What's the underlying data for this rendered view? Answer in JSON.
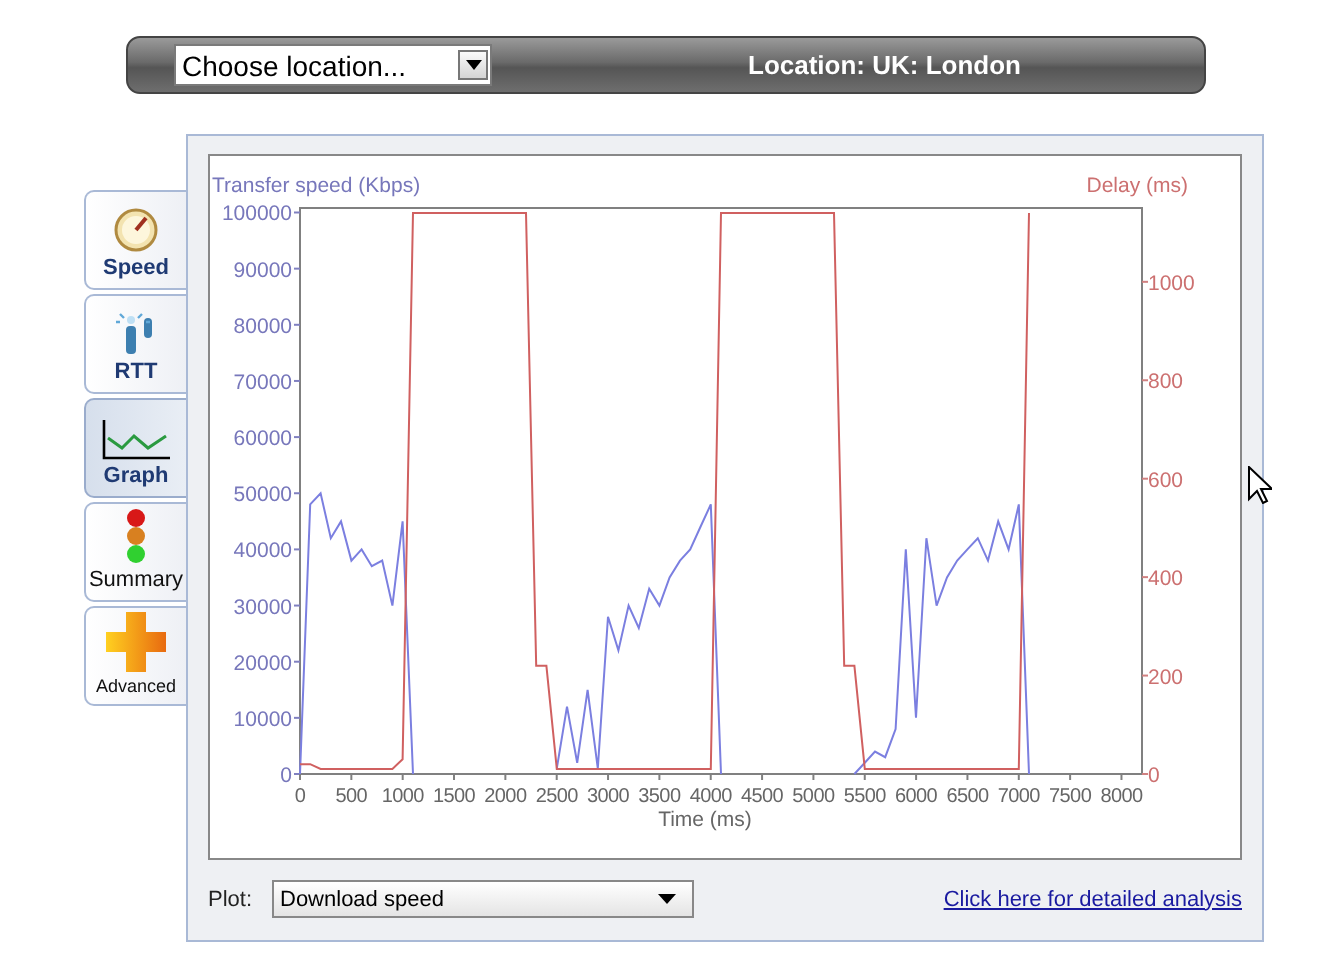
{
  "header": {
    "location_select": {
      "value": "Choose location..."
    },
    "location_label": "Location: UK: London"
  },
  "tabs": [
    {
      "label": "Speed",
      "kind": "gauge",
      "selected": false
    },
    {
      "label": "RTT",
      "kind": "antenna",
      "selected": false
    },
    {
      "label": "Graph",
      "kind": "graph",
      "selected": true
    },
    {
      "label": "Summary",
      "kind": "lights",
      "selected": false
    },
    {
      "label": "Advanced",
      "kind": "plus",
      "selected": false
    }
  ],
  "chart_data": {
    "type": "line",
    "xlabel": "Time (ms)",
    "ylabel": "Transfer speed (Kbps)",
    "y2label": "Delay (ms)",
    "x": [
      0,
      100,
      200,
      300,
      400,
      500,
      600,
      700,
      800,
      900,
      1000,
      1100,
      1200,
      1300,
      1400,
      1500,
      1600,
      1700,
      1800,
      1900,
      2000,
      2100,
      2200,
      2300,
      2400,
      2500,
      2600,
      2700,
      2800,
      2900,
      3000,
      3100,
      3200,
      3300,
      3400,
      3500,
      3600,
      3700,
      3800,
      3900,
      4000,
      4100,
      4200,
      4300,
      4400,
      4500,
      4600,
      4700,
      4800,
      4900,
      5000,
      5100,
      5200,
      5300,
      5400,
      5500,
      5600,
      5700,
      5800,
      5900,
      6000,
      6100,
      6200,
      6300,
      6400,
      6500,
      6600,
      6700,
      6800,
      6900,
      7000,
      7100
    ],
    "series": [
      {
        "color": "#7b7fe0",
        "values": [
          0,
          48000,
          50000,
          42000,
          45000,
          38000,
          40000,
          37000,
          38000,
          30000,
          45000,
          0,
          null,
          null,
          null,
          null,
          null,
          null,
          null,
          null,
          null,
          null,
          null,
          null,
          null,
          1000,
          12000,
          2000,
          15000,
          1000,
          28000,
          22000,
          30000,
          26000,
          33000,
          30000,
          35000,
          38000,
          40000,
          44000,
          48000,
          0,
          null,
          null,
          null,
          null,
          null,
          null,
          null,
          null,
          null,
          null,
          null,
          null,
          0,
          2000,
          4000,
          3000,
          8000,
          40000,
          10000,
          42000,
          30000,
          35000,
          38000,
          40000,
          42000,
          38000,
          45000,
          40000,
          48000,
          0
        ]
      },
      {
        "color": "#d06060",
        "axis": "y2",
        "values": [
          20,
          20,
          10,
          10,
          10,
          10,
          10,
          10,
          10,
          10,
          30,
          1140,
          1140,
          1140,
          1140,
          1140,
          1140,
          1140,
          1140,
          1140,
          1140,
          1140,
          1140,
          220,
          220,
          10,
          10,
          10,
          10,
          10,
          10,
          10,
          10,
          10,
          10,
          10,
          10,
          10,
          10,
          10,
          10,
          1140,
          1140,
          1140,
          1140,
          1140,
          1140,
          1140,
          1140,
          1140,
          1140,
          1140,
          1140,
          220,
          220,
          10,
          10,
          10,
          10,
          10,
          10,
          10,
          10,
          10,
          10,
          10,
          10,
          10,
          10,
          10,
          10,
          1140
        ]
      }
    ],
    "xlim": [
      0,
      8200
    ],
    "ylim": [
      0,
      100800
    ],
    "y2lim": [
      0,
      1150
    ],
    "xticks": [
      0,
      500,
      1000,
      1500,
      2000,
      2500,
      3000,
      3500,
      4000,
      4500,
      5000,
      5500,
      6000,
      6500,
      7000,
      7500,
      8000
    ],
    "yticks": [
      0,
      10000,
      20000,
      30000,
      40000,
      50000,
      60000,
      70000,
      80000,
      90000,
      100000
    ],
    "y2ticks": [
      0,
      200,
      400,
      600,
      800,
      1000
    ]
  },
  "plot": {
    "label": "Plot:",
    "select": {
      "value": "Download speed"
    }
  },
  "analysis_link": "Click here for detailed analysis"
}
